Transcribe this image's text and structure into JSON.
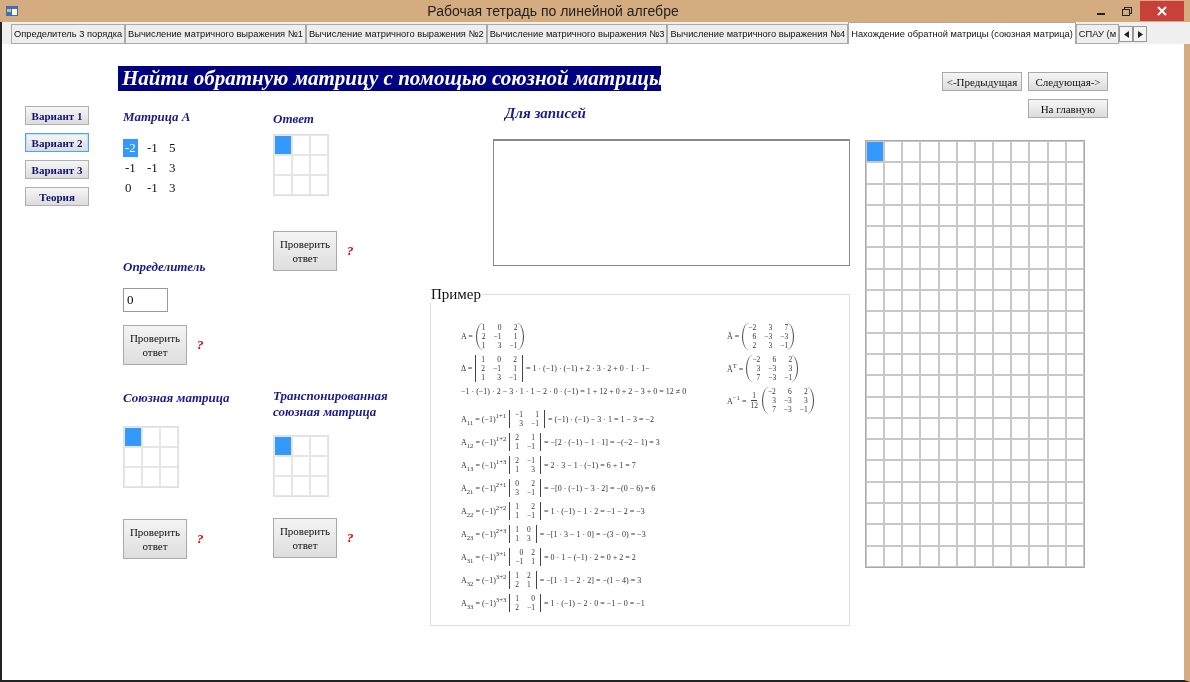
{
  "window": {
    "title": "Рабочая тетрадь по линейной алгебре"
  },
  "tabs": [
    {
      "label": "Определитель 3 порядка",
      "selected": false
    },
    {
      "label": "Вычисление матричного выражения №1",
      "selected": false
    },
    {
      "label": "Вычисление матричного выражения №2",
      "selected": false
    },
    {
      "label": "Вычисление матричного выражения №3",
      "selected": false
    },
    {
      "label": "Вычисление матричного выражения №4",
      "selected": false
    },
    {
      "label": "Нахождение обратной матрицы (союзная матрица)",
      "selected": true
    },
    {
      "label": "СПАУ (м",
      "selected": false
    }
  ],
  "page_title": "Найти обратную матрицу с помощью союзной матрицы",
  "variants": [
    {
      "label": "Вариант 1",
      "selected": false
    },
    {
      "label": "Вариант 2",
      "selected": true
    },
    {
      "label": "Вариант 3",
      "selected": false
    },
    {
      "label": "Теория",
      "selected": false
    }
  ],
  "matrix_a": {
    "label": "Матрица А",
    "rows": [
      [
        {
          "value": "-2",
          "selected": true
        },
        {
          "value": "-1",
          "selected": false
        },
        {
          "value": "5",
          "selected": false
        }
      ],
      [
        {
          "value": "-1",
          "selected": false
        },
        {
          "value": "-1",
          "selected": false
        },
        {
          "value": "3",
          "selected": false
        }
      ],
      [
        {
          "value": "0",
          "selected": false
        },
        {
          "value": "-1",
          "selected": false
        },
        {
          "value": "3",
          "selected": false
        }
      ]
    ]
  },
  "answer": {
    "label": "Ответ",
    "cells": [
      [
        true,
        false,
        false
      ],
      [
        false,
        false,
        false
      ],
      [
        false,
        false,
        false
      ]
    ],
    "check": {
      "button": "Проверить ответ",
      "hint": "?"
    }
  },
  "determinant": {
    "label": "Определитель",
    "value": "0",
    "check": {
      "button": "Проверить ответ",
      "hint": "?"
    }
  },
  "adjugate": {
    "label": "Союзная матрица",
    "cells": [
      [
        true,
        false,
        false
      ],
      [
        false,
        false,
        false
      ],
      [
        false,
        false,
        false
      ]
    ],
    "check": {
      "button": "Проверить ответ",
      "hint": "?"
    }
  },
  "transposed": {
    "label": "Транспонированная союзная матрица",
    "cells": [
      [
        true,
        false,
        false
      ],
      [
        false,
        false,
        false
      ],
      [
        false,
        false,
        false
      ]
    ],
    "check": {
      "button": "Проверить ответ",
      "hint": "?"
    }
  },
  "notes": {
    "label": "Для записей"
  },
  "example": {
    "legend": "Пример",
    "columns": [
      {
        "groups": [
          {
            "formulas": [
              {
                "kind": "matrix",
                "lhs": "A =",
                "matrix": [
                  [
                    "1",
                    "0",
                    "2"
                  ],
                  [
                    "2",
                    "−1",
                    "1"
                  ],
                  [
                    "1",
                    "3",
                    "−1"
                  ]
                ]
              },
              {
                "kind": "determinant",
                "lhs": "Δ =",
                "matrix": [
                  [
                    "1",
                    "0",
                    "2"
                  ],
                  [
                    "2",
                    "−1",
                    "1"
                  ],
                  [
                    "1",
                    "3",
                    "−1"
                  ]
                ],
                "rhs": "= 1 · (−1) · (−1) + 2 · 3 · 2 + 0 · 1 · 1−"
              },
              {
                "kind": "line",
                "text": "−1 · (−1) · 2 − 3 · 1 · 1 − 2 · 0 · (−1) = 1 + 12 + 0 + 2 − 3 + 0 = 12 ≠ 0"
              }
            ]
          },
          {
            "formulas": [
              {
                "kind": "determinant",
                "lhs": "A$_{11}$ = (−1)$^{1+1}$",
                "matrix": [
                  [
                    "−1",
                    "1"
                  ],
                  [
                    "3",
                    "−1"
                  ]
                ],
                "rhs": "= (−1) · (−1) − 3 · 1 = 1 − 3 = −2"
              },
              {
                "kind": "determinant",
                "lhs": "A$_{12}$ = (−1)$^{1+2}$",
                "matrix": [
                  [
                    "2",
                    "1"
                  ],
                  [
                    "1",
                    "−1"
                  ]
                ],
                "rhs": "= −[2 · (−1) − 1 · 1] = −(−2 − 1) = 3"
              },
              {
                "kind": "determinant",
                "lhs": "A$_{13}$ = (−1)$^{1+3}$",
                "matrix": [
                  [
                    "2",
                    "−1"
                  ],
                  [
                    "1",
                    "3"
                  ]
                ],
                "rhs": "= 2 · 3 − 1 · (−1) = 6 + 1 = 7"
              },
              {
                "kind": "determinant",
                "lhs": "A$_{21}$ = (−1)$^{2+1}$",
                "matrix": [
                  [
                    "0",
                    "2"
                  ],
                  [
                    "3",
                    "−1"
                  ]
                ],
                "rhs": "= −[0 · (−1) − 3 · 2] = −(0 − 6) = 6"
              },
              {
                "kind": "determinant",
                "lhs": "A$_{22}$ = (−1)$^{2+2}$",
                "matrix": [
                  [
                    "1",
                    "2"
                  ],
                  [
                    "1",
                    "−1"
                  ]
                ],
                "rhs": "= 1 · (−1) − 1 · 2 = −1 − 2 = −3"
              },
              {
                "kind": "determinant",
                "lhs": "A$_{23}$ = (−1)$^{2+3}$",
                "matrix": [
                  [
                    "1",
                    "0"
                  ],
                  [
                    "1",
                    "3"
                  ]
                ],
                "rhs": "= −[1 · 3 − 1 · 0] = −(3 − 0) = −3"
              },
              {
                "kind": "determinant",
                "lhs": "A$_{31}$ = (−1)$^{3+1}$",
                "matrix": [
                  [
                    "0",
                    "2"
                  ],
                  [
                    "−1",
                    "1"
                  ]
                ],
                "rhs": "= 0 · 1 − (−1) · 2 = 0 + 2 = 2"
              },
              {
                "kind": "determinant",
                "lhs": "A$_{32}$ = (−1)$^{3+2}$",
                "matrix": [
                  [
                    "1",
                    "2"
                  ],
                  [
                    "2",
                    "1"
                  ]
                ],
                "rhs": "= −[1 · 1 − 2 · 2] = −(1 − 4) = 3"
              },
              {
                "kind": "determinant",
                "lhs": "A$_{33}$ = (−1)$^{3+3}$",
                "matrix": [
                  [
                    "1",
                    "0"
                  ],
                  [
                    "2",
                    "−1"
                  ]
                ],
                "rhs": "= 1 · (−1) − 2 · 0 = −1 − 0 = −1"
              }
            ]
          }
        ]
      },
      {
        "groups": [
          {
            "formulas": [
              {
                "kind": "matrix",
                "lhs": "Ã =",
                "matrix": [
                  [
                    "−2",
                    "3",
                    "7"
                  ],
                  [
                    "6",
                    "−3",
                    "−3"
                  ],
                  [
                    "2",
                    "3",
                    "−1"
                  ]
                ]
              },
              {
                "kind": "matrix",
                "lhs": "Ã$^{T}$ =",
                "matrix": [
                  [
                    "−2",
                    "6",
                    "2"
                  ],
                  [
                    "3",
                    "−3",
                    "3"
                  ],
                  [
                    "7",
                    "−3",
                    "−1"
                  ]
                ]
              },
              {
                "kind": "matrix",
                "lhs": "A$^{−1}$ =",
                "coefficient": {
                  "num": "1",
                  "den": "12"
                },
                "matrix": [
                  [
                    "−2",
                    "6",
                    "2"
                  ],
                  [
                    "3",
                    "−3",
                    "3"
                  ],
                  [
                    "7",
                    "−3",
                    "−1"
                  ]
                ]
              }
            ]
          }
        ]
      }
    ]
  },
  "nav": {
    "previous": "<-Предыдущая",
    "next": "Следующая->",
    "home": "На главную"
  },
  "grid": {
    "cells": [
      [
        true,
        false,
        false,
        false,
        false,
        false,
        false,
        false,
        false,
        false,
        false,
        false
      ],
      [
        false,
        false,
        false,
        false,
        false,
        false,
        false,
        false,
        false,
        false,
        false,
        false
      ],
      [
        false,
        false,
        false,
        false,
        false,
        false,
        false,
        false,
        false,
        false,
        false,
        false
      ],
      [
        false,
        false,
        false,
        false,
        false,
        false,
        false,
        false,
        false,
        false,
        false,
        false
      ],
      [
        false,
        false,
        false,
        false,
        false,
        false,
        false,
        false,
        false,
        false,
        false,
        false
      ],
      [
        false,
        false,
        false,
        false,
        false,
        false,
        false,
        false,
        false,
        false,
        false,
        false
      ],
      [
        false,
        false,
        false,
        false,
        false,
        false,
        false,
        false,
        false,
        false,
        false,
        false
      ],
      [
        false,
        false,
        false,
        false,
        false,
        false,
        false,
        false,
        false,
        false,
        false,
        false
      ],
      [
        false,
        false,
        false,
        false,
        false,
        false,
        false,
        false,
        false,
        false,
        false,
        false
      ],
      [
        false,
        false,
        false,
        false,
        false,
        false,
        false,
        false,
        false,
        false,
        false,
        false
      ],
      [
        false,
        false,
        false,
        false,
        false,
        false,
        false,
        false,
        false,
        false,
        false,
        false
      ],
      [
        false,
        false,
        false,
        false,
        false,
        false,
        false,
        false,
        false,
        false,
        false,
        false
      ],
      [
        false,
        false,
        false,
        false,
        false,
        false,
        false,
        false,
        false,
        false,
        false,
        false
      ],
      [
        false,
        false,
        false,
        false,
        false,
        false,
        false,
        false,
        false,
        false,
        false,
        false
      ],
      [
        false,
        false,
        false,
        false,
        false,
        false,
        false,
        false,
        false,
        false,
        false,
        false
      ],
      [
        false,
        false,
        false,
        false,
        false,
        false,
        false,
        false,
        false,
        false,
        false,
        false
      ],
      [
        false,
        false,
        false,
        false,
        false,
        false,
        false,
        false,
        false,
        false,
        false,
        false
      ],
      [
        false,
        false,
        false,
        false,
        false,
        false,
        false,
        false,
        false,
        false,
        false,
        false
      ],
      [
        false,
        false,
        false,
        false,
        false,
        false,
        false,
        false,
        false,
        false,
        false,
        false
      ],
      [
        false,
        false,
        false,
        false,
        false,
        false,
        false,
        false,
        false,
        false,
        false,
        false
      ]
    ]
  }
}
